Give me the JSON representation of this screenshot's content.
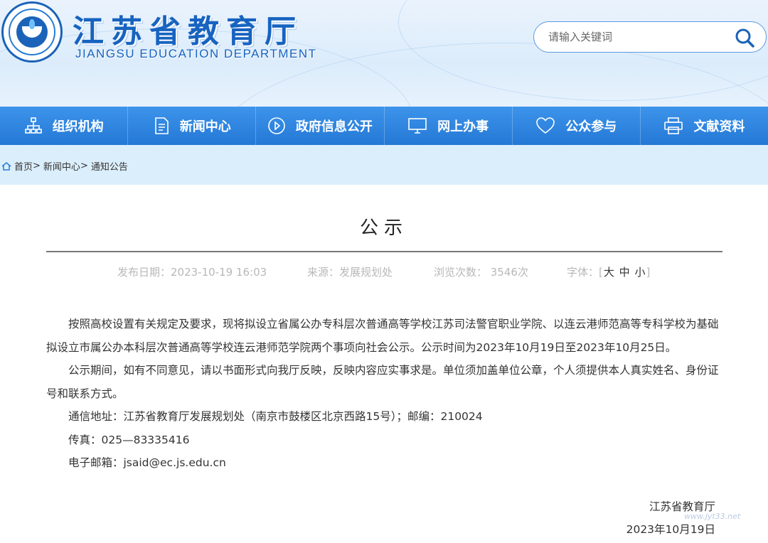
{
  "header": {
    "title_cn": "江苏省教育厅",
    "title_en": "JIANGSU EDUCATION DEPARTMENT",
    "search_placeholder": "请输入关键词"
  },
  "nav": {
    "items": [
      {
        "label": "组织机构",
        "icon": "org-chart-icon"
      },
      {
        "label": "新闻中心",
        "icon": "document-icon"
      },
      {
        "label": "政府信息公开",
        "icon": "play-icon"
      },
      {
        "label": "网上办事",
        "icon": "monitor-icon"
      },
      {
        "label": "公众参与",
        "icon": "heart-icon"
      },
      {
        "label": "文献资料",
        "icon": "printer-icon"
      }
    ]
  },
  "breadcrumb": {
    "home": "首页",
    "sep": ">",
    "level2": "新闻中心",
    "level3": "通知公告"
  },
  "article": {
    "title": "公示",
    "meta": {
      "date": "发布日期：2023-10-19 16:03",
      "source": "来源：发展规划处",
      "views": "浏览次数： 3546次",
      "font_label": "字体：",
      "bracket_open": "[",
      "font_large": "大",
      "font_medium": "中",
      "font_small": "小",
      "bracket_close": "]"
    },
    "paragraphs": [
      "按照高校设置有关规定及要求，现将拟设立省属公办专科层次普通高等学校江苏司法警官职业学院、以连云港师范高等专科学校为基础拟设立市属公办本科层次普通高等学校连云港师范学院两个事项向社会公示。公示时间为2023年10月19日至2023年10月25日。",
      "公示期间，如有不同意见，请以书面形式向我厅反映，反映内容应实事求是。单位须加盖单位公章，个人须提供本人真实姓名、身份证号和联系方式。",
      "通信地址：江苏省教育厅发展规划处（南京市鼓楼区北京西路15号）；邮编：210024",
      "传真：025—83335416",
      "电子邮箱：jsaid@ec.js.edu.cn"
    ],
    "signature": {
      "org": "江苏省教育厅",
      "date": "2023年10月19日"
    }
  },
  "watermark": "www.jyt33.net",
  "colors": {
    "brand_blue": "#1763c0",
    "nav_blue": "#2478d6",
    "crumb_bg": "#dbeefb"
  }
}
